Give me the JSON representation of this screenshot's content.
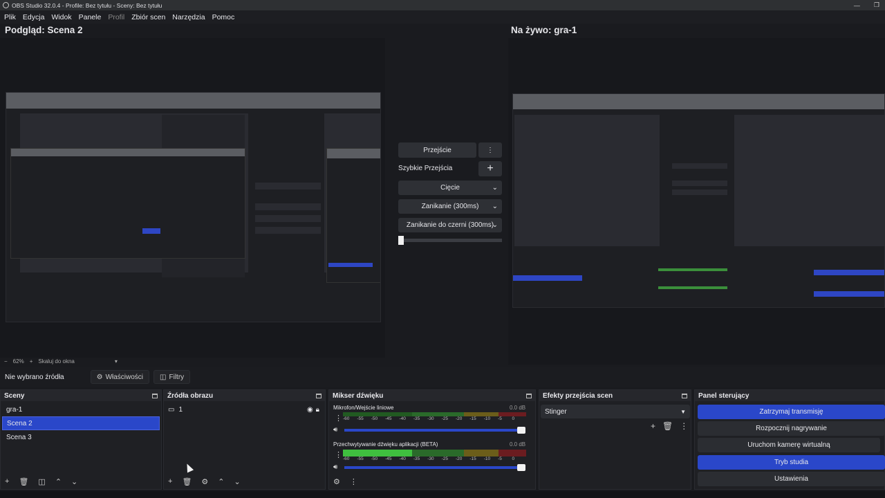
{
  "window": {
    "title": "OBS Studio 32.0.4 - Profile: Bez tytułu - Sceny: Bez tytułu"
  },
  "menu": [
    "Plik",
    "Edycja",
    "Widok",
    "Panele",
    "Profil",
    "Zbiór scen",
    "Narzędzia",
    "Pomoc"
  ],
  "preview": {
    "title": "Podgląd: Scena 2",
    "zoom": "62%",
    "scale_mode": "Skaluj do okna"
  },
  "program": {
    "title": "Na żywo: gra-1"
  },
  "transitions_mid": {
    "transition_button": "Przejście",
    "quick_label": "Szybkie Przejścia",
    "quick": [
      "Cięcie",
      "Zanikanie (300ms)",
      "Zanikanie do czerni (300ms)"
    ],
    "tbar_value": 0
  },
  "source_bar": {
    "no_source": "Nie wybrano źródła",
    "properties": "Właściwości",
    "filters": "Filtry"
  },
  "scenes": {
    "title": "Sceny",
    "items": [
      "gra-1",
      "Scena 2",
      "Scena 3"
    ],
    "selected": 1
  },
  "sources": {
    "title": "Źródła obrazu",
    "items": [
      "1"
    ]
  },
  "mixer": {
    "title": "Mikser dźwięku",
    "channels": [
      {
        "name": "Mikrofon/Wejście liniowe",
        "db": "0.0 dB"
      },
      {
        "name": "Przechwytywanie dźwięku aplikacji (BETA)",
        "db": "0.0 dB"
      }
    ],
    "scale": [
      "-60",
      "-55",
      "-50",
      "-45",
      "-40",
      "-35",
      "-30",
      "-25",
      "-20",
      "-15",
      "-10",
      "-5",
      "0"
    ]
  },
  "scene_transitions": {
    "title": "Efekty przejścia scen",
    "selected": "Stinger"
  },
  "controls": {
    "title": "Panel sterujący",
    "stop_stream": "Zatrzymaj transmisję",
    "start_record": "Rozpocznij nagrywanie",
    "virtual_cam": "Uruchom kamerę wirtualną",
    "studio_mode": "Tryb studia",
    "settings": "Ustawienia"
  },
  "colors": {
    "accent": "#2a47c9",
    "bg": "#1a1b1f",
    "panel": "#1f2024"
  }
}
